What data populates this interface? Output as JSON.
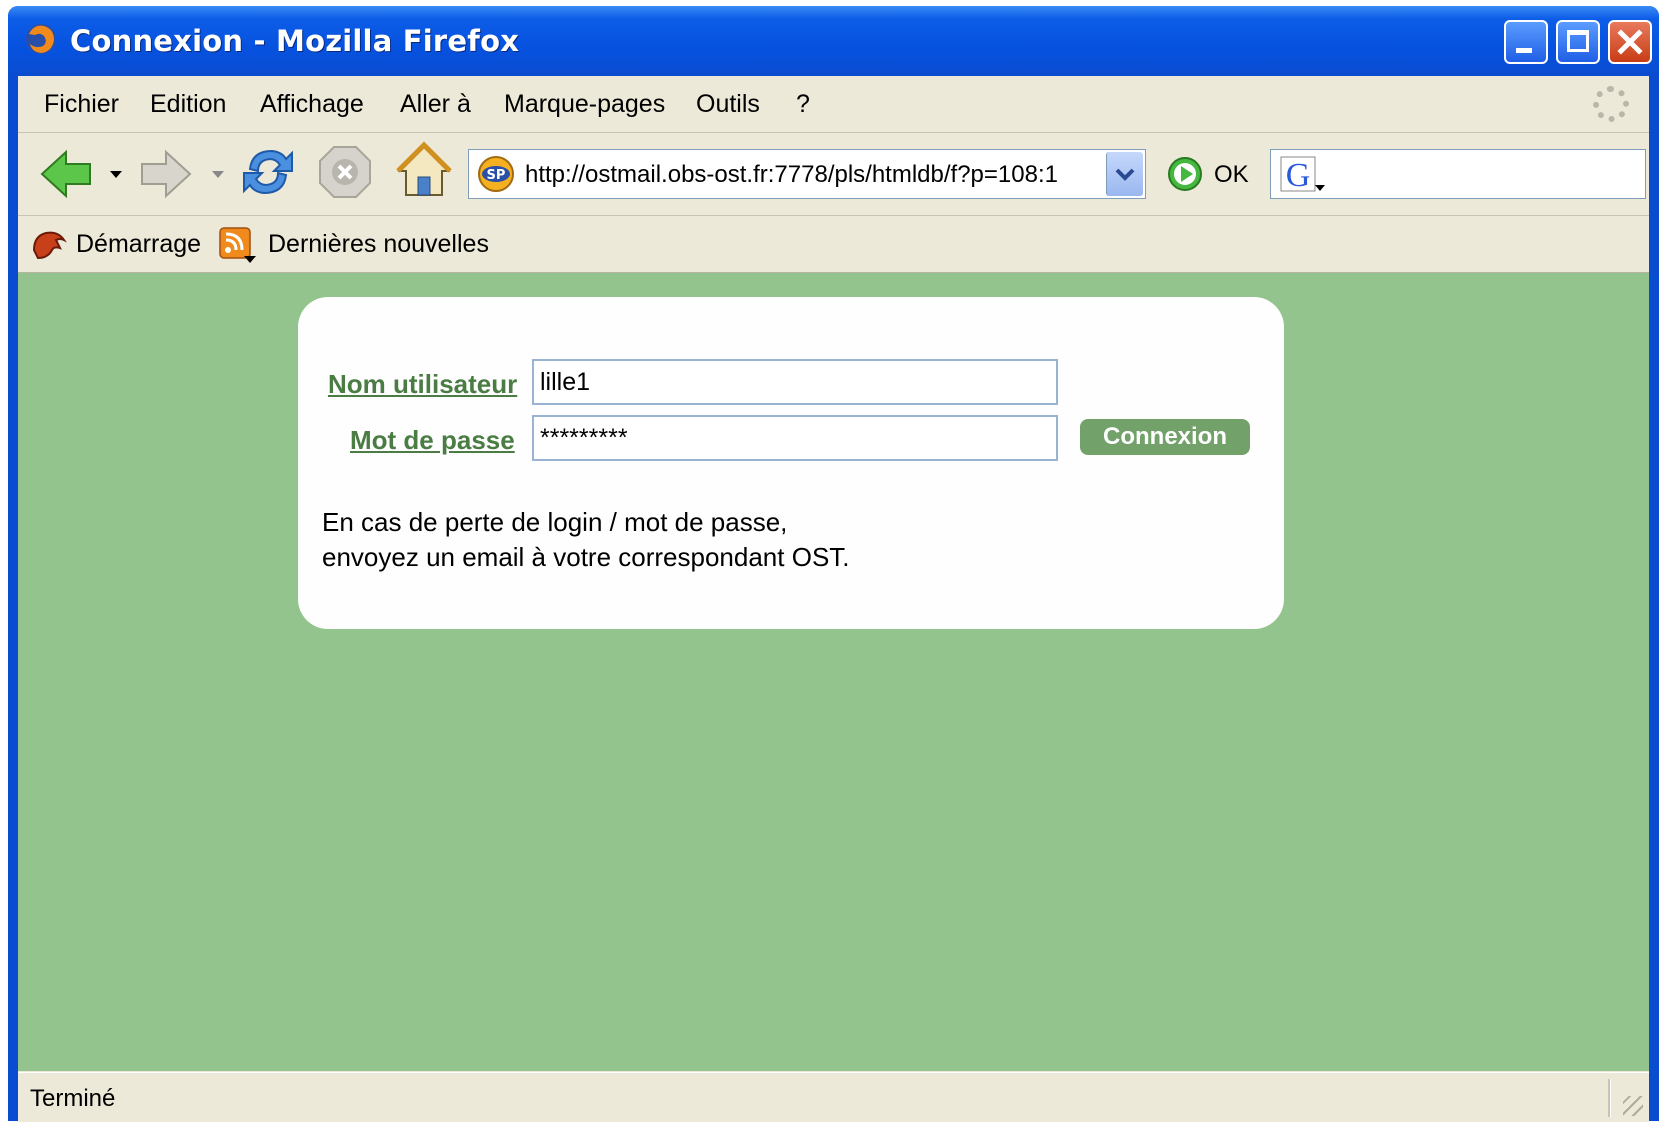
{
  "window": {
    "title": "Connexion - Mozilla Firefox"
  },
  "menu": {
    "items": [
      {
        "label": "Fichier"
      },
      {
        "label": "Edition"
      },
      {
        "label": "Affichage"
      },
      {
        "label": "Aller à"
      },
      {
        "label": "Marque-pages"
      },
      {
        "label": "Outils"
      },
      {
        "label": "?"
      }
    ]
  },
  "navigation": {
    "url": "http://ostmail.obs-ost.fr:7778/pls/htmldb/f?p=108:1",
    "go_label": "OK",
    "icons": [
      "back-icon",
      "forward-icon",
      "reload-icon",
      "stop-icon",
      "home-icon",
      "go-icon",
      "google-search-icon"
    ]
  },
  "bookmarks": {
    "items": [
      {
        "label": "Démarrage",
        "icon": "getting-started-icon"
      },
      {
        "label": "Dernières nouvelles",
        "icon": "rss-feed-icon"
      }
    ]
  },
  "login": {
    "username_label": "Nom utilisateur",
    "username_value": "lille1",
    "password_label": "Mot de passe",
    "password_value": "*********",
    "submit_label": "Connexion",
    "help_line1": "En cas de perte de login / mot de passe,",
    "help_line2": "envoyez un email à votre correspondant OST."
  },
  "status": {
    "text": "Terminé"
  },
  "colors": {
    "page_background": "#94c48e",
    "label_color": "#4a7c44",
    "button_color": "#72a26a",
    "titlebar": "#0a4cd0"
  }
}
